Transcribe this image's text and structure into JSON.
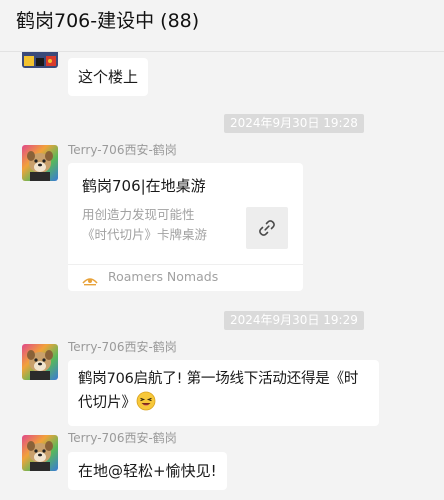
{
  "header": {
    "title": "鹤岗706-建设中 (88)"
  },
  "messages": {
    "m1": {
      "text": "这个楼上"
    },
    "ts1": "2024年9月30日 19:28",
    "m2": {
      "sender": "Terry-706西安-鹤岗",
      "card": {
        "title": "鹤岗706|在地桌游",
        "desc_line1": "用创造力发现可能性",
        "desc_line2": "《时代切片》卡牌桌游",
        "source": "Roamers Nomads",
        "thumb_icon": "link-icon"
      }
    },
    "ts2": "2024年9月30日 19:29",
    "m3": {
      "sender": "Terry-706西安-鹤岗",
      "line1": "鹤岗706启航了! 第一场线下活动还得是《时",
      "line2": "代切片》",
      "emoji": "grinning-squinting-face"
    },
    "m4": {
      "sender": "Terry-706西安-鹤岗",
      "text": "在地@轻松+愉快见!"
    }
  },
  "colors": {
    "background": "#f3f3f3",
    "bubble": "#ffffff",
    "timestamp_bg": "#dadada",
    "sender_text": "#9a9a9a"
  }
}
